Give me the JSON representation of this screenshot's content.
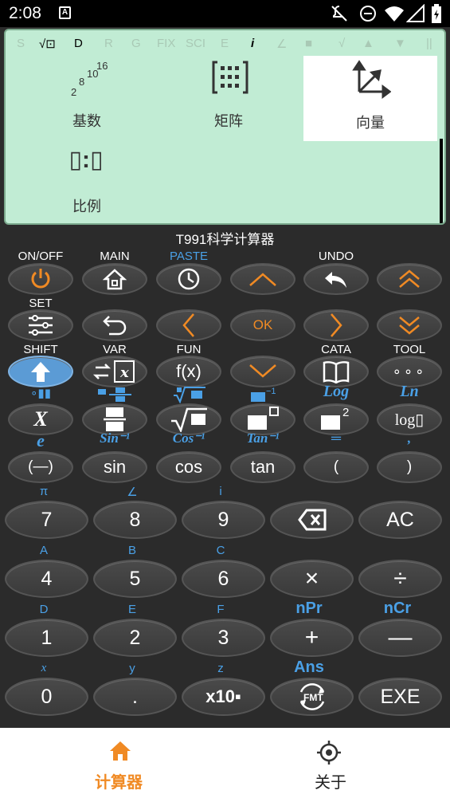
{
  "status": {
    "time": "2:08"
  },
  "indicators": [
    {
      "text": "S",
      "on": false
    },
    {
      "text": "√⊡",
      "on": true
    },
    {
      "text": "D",
      "on": true
    },
    {
      "text": "R",
      "on": false
    },
    {
      "text": "G",
      "on": false
    },
    {
      "text": "FIX",
      "on": false
    },
    {
      "text": "SCI",
      "on": false
    },
    {
      "text": "E",
      "on": false
    },
    {
      "text": "i",
      "on": true
    },
    {
      "text": "∠",
      "on": false
    },
    {
      "text": "■",
      "on": false
    },
    {
      "text": "√",
      "on": false
    },
    {
      "text": "▲",
      "on": false
    },
    {
      "text": "▼",
      "on": false
    },
    {
      "text": "||",
      "on": false
    }
  ],
  "menu": {
    "items": [
      {
        "label": "基数",
        "selected": false
      },
      {
        "label": "矩阵",
        "selected": false
      },
      {
        "label": "向量",
        "selected": true
      },
      {
        "label": "比例",
        "selected": false
      }
    ],
    "base_digits": {
      "d2": "2",
      "d8": "8",
      "d10": "10",
      "d16": "16"
    },
    "ratio_icon": "▯:▯"
  },
  "app_title": "T991科学计算器",
  "func_keys": {
    "row1": {
      "labels": [
        "ON/OFF",
        "MAIN",
        "PASTE",
        "",
        "UNDO",
        ""
      ],
      "icons": [
        "power-icon",
        "home-icon",
        "clock-icon",
        "up-arrow-icon",
        "undo-icon",
        "double-up-icon"
      ]
    },
    "row2": {
      "labels": [
        "SET",
        "",
        "",
        "",
        "",
        ""
      ],
      "ok": "OK"
    },
    "row3": {
      "labels": [
        "SHIFT",
        "VAR",
        "FUN",
        "",
        "CATA",
        "TOOL"
      ],
      "fx": "f(x)",
      "tool": "∘∘∘"
    },
    "row4": {
      "top": [
        "∘▮▮",
        "",
        "",
        "",
        "Log",
        "Ln"
      ],
      "keys": [
        "X",
        "",
        "√▭",
        "",
        "",
        "log▯"
      ]
    },
    "row5": {
      "top": [
        "e",
        "Sin⁻¹",
        "Cos⁻¹",
        "Tan⁻¹",
        "═",
        ","
      ],
      "keys": [
        "(—)",
        "sin",
        "cos",
        "tan",
        "(",
        ")"
      ]
    }
  },
  "num_keys": {
    "row1": {
      "top": [
        "π",
        "∠",
        "i",
        "",
        ""
      ],
      "keys": [
        "7",
        "8",
        "9",
        "⌫",
        "AC"
      ]
    },
    "row2": {
      "top": [
        "A",
        "B",
        "C",
        "",
        ""
      ],
      "keys": [
        "4",
        "5",
        "6",
        "×",
        "÷"
      ]
    },
    "row3": {
      "top": [
        "D",
        "E",
        "F",
        "nPr",
        "nCr"
      ],
      "keys": [
        "1",
        "2",
        "3",
        "+",
        "—"
      ]
    },
    "row4": {
      "top": [
        "x",
        "y",
        "z",
        "Ans",
        ""
      ],
      "keys": [
        "0",
        ".",
        "x10▪",
        "FMT",
        "EXE"
      ]
    }
  },
  "nav": {
    "calc_label": "计算器",
    "about_label": "关于"
  },
  "colors": {
    "accent": "#f08a24",
    "screen": "#c1ecd4",
    "blue": "#4aa0e6"
  }
}
